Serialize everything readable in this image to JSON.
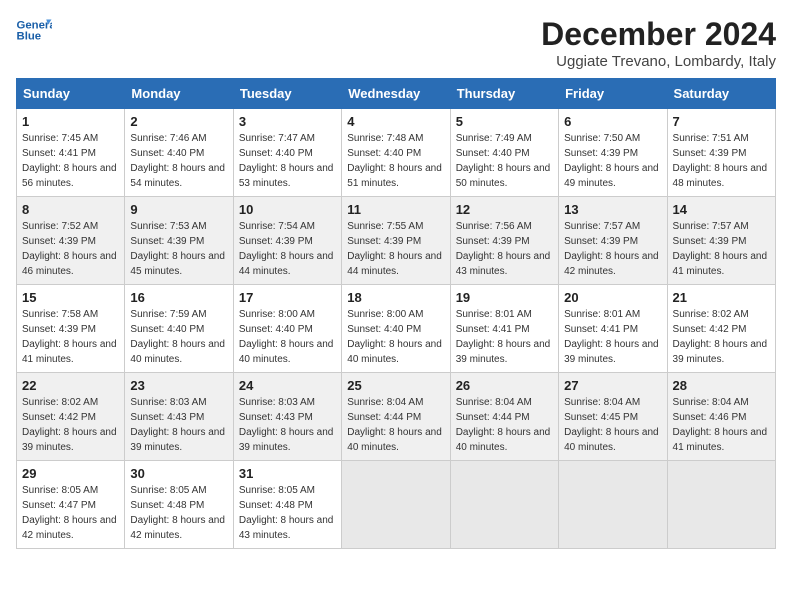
{
  "header": {
    "logo_line1": "General",
    "logo_line2": "Blue",
    "month_title": "December 2024",
    "location": "Uggiate Trevano, Lombardy, Italy"
  },
  "weekdays": [
    "Sunday",
    "Monday",
    "Tuesday",
    "Wednesday",
    "Thursday",
    "Friday",
    "Saturday"
  ],
  "weeks": [
    [
      {
        "day": "1",
        "sunrise": "7:45 AM",
        "sunset": "4:41 PM",
        "daylight": "8 hours and 56 minutes."
      },
      {
        "day": "2",
        "sunrise": "7:46 AM",
        "sunset": "4:40 PM",
        "daylight": "8 hours and 54 minutes."
      },
      {
        "day": "3",
        "sunrise": "7:47 AM",
        "sunset": "4:40 PM",
        "daylight": "8 hours and 53 minutes."
      },
      {
        "day": "4",
        "sunrise": "7:48 AM",
        "sunset": "4:40 PM",
        "daylight": "8 hours and 51 minutes."
      },
      {
        "day": "5",
        "sunrise": "7:49 AM",
        "sunset": "4:40 PM",
        "daylight": "8 hours and 50 minutes."
      },
      {
        "day": "6",
        "sunrise": "7:50 AM",
        "sunset": "4:39 PM",
        "daylight": "8 hours and 49 minutes."
      },
      {
        "day": "7",
        "sunrise": "7:51 AM",
        "sunset": "4:39 PM",
        "daylight": "8 hours and 48 minutes."
      }
    ],
    [
      {
        "day": "8",
        "sunrise": "7:52 AM",
        "sunset": "4:39 PM",
        "daylight": "8 hours and 46 minutes."
      },
      {
        "day": "9",
        "sunrise": "7:53 AM",
        "sunset": "4:39 PM",
        "daylight": "8 hours and 45 minutes."
      },
      {
        "day": "10",
        "sunrise": "7:54 AM",
        "sunset": "4:39 PM",
        "daylight": "8 hours and 44 minutes."
      },
      {
        "day": "11",
        "sunrise": "7:55 AM",
        "sunset": "4:39 PM",
        "daylight": "8 hours and 44 minutes."
      },
      {
        "day": "12",
        "sunrise": "7:56 AM",
        "sunset": "4:39 PM",
        "daylight": "8 hours and 43 minutes."
      },
      {
        "day": "13",
        "sunrise": "7:57 AM",
        "sunset": "4:39 PM",
        "daylight": "8 hours and 42 minutes."
      },
      {
        "day": "14",
        "sunrise": "7:57 AM",
        "sunset": "4:39 PM",
        "daylight": "8 hours and 41 minutes."
      }
    ],
    [
      {
        "day": "15",
        "sunrise": "7:58 AM",
        "sunset": "4:39 PM",
        "daylight": "8 hours and 41 minutes."
      },
      {
        "day": "16",
        "sunrise": "7:59 AM",
        "sunset": "4:40 PM",
        "daylight": "8 hours and 40 minutes."
      },
      {
        "day": "17",
        "sunrise": "8:00 AM",
        "sunset": "4:40 PM",
        "daylight": "8 hours and 40 minutes."
      },
      {
        "day": "18",
        "sunrise": "8:00 AM",
        "sunset": "4:40 PM",
        "daylight": "8 hours and 40 minutes."
      },
      {
        "day": "19",
        "sunrise": "8:01 AM",
        "sunset": "4:41 PM",
        "daylight": "8 hours and 39 minutes."
      },
      {
        "day": "20",
        "sunrise": "8:01 AM",
        "sunset": "4:41 PM",
        "daylight": "8 hours and 39 minutes."
      },
      {
        "day": "21",
        "sunrise": "8:02 AM",
        "sunset": "4:42 PM",
        "daylight": "8 hours and 39 minutes."
      }
    ],
    [
      {
        "day": "22",
        "sunrise": "8:02 AM",
        "sunset": "4:42 PM",
        "daylight": "8 hours and 39 minutes."
      },
      {
        "day": "23",
        "sunrise": "8:03 AM",
        "sunset": "4:43 PM",
        "daylight": "8 hours and 39 minutes."
      },
      {
        "day": "24",
        "sunrise": "8:03 AM",
        "sunset": "4:43 PM",
        "daylight": "8 hours and 39 minutes."
      },
      {
        "day": "25",
        "sunrise": "8:04 AM",
        "sunset": "4:44 PM",
        "daylight": "8 hours and 40 minutes."
      },
      {
        "day": "26",
        "sunrise": "8:04 AM",
        "sunset": "4:44 PM",
        "daylight": "8 hours and 40 minutes."
      },
      {
        "day": "27",
        "sunrise": "8:04 AM",
        "sunset": "4:45 PM",
        "daylight": "8 hours and 40 minutes."
      },
      {
        "day": "28",
        "sunrise": "8:04 AM",
        "sunset": "4:46 PM",
        "daylight": "8 hours and 41 minutes."
      }
    ],
    [
      {
        "day": "29",
        "sunrise": "8:05 AM",
        "sunset": "4:47 PM",
        "daylight": "8 hours and 42 minutes."
      },
      {
        "day": "30",
        "sunrise": "8:05 AM",
        "sunset": "4:48 PM",
        "daylight": "8 hours and 42 minutes."
      },
      {
        "day": "31",
        "sunrise": "8:05 AM",
        "sunset": "4:48 PM",
        "daylight": "8 hours and 43 minutes."
      },
      null,
      null,
      null,
      null
    ]
  ]
}
